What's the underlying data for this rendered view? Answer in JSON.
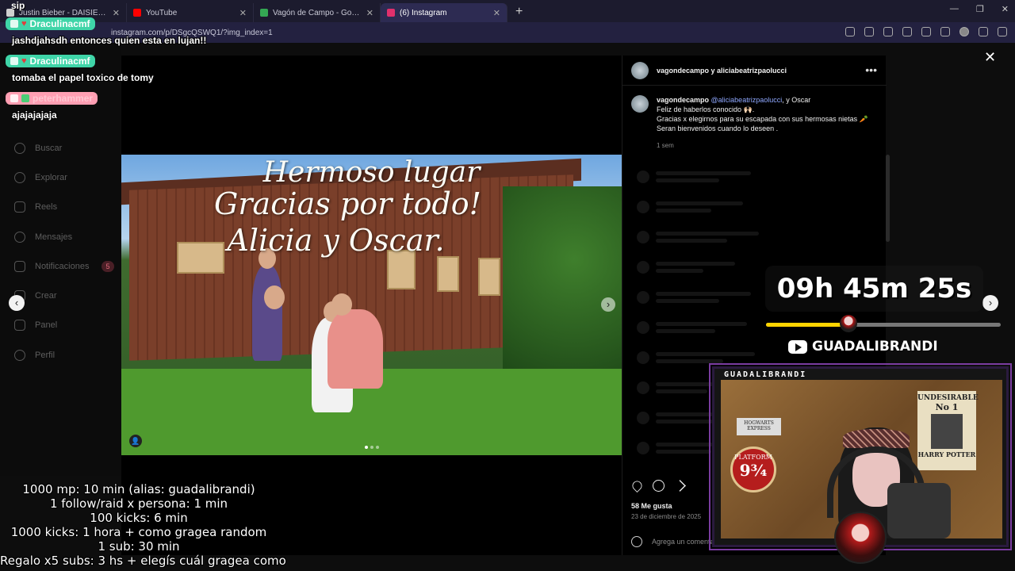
{
  "browser": {
    "tabs": [
      {
        "title": "Justin Bieber - DAISIES (Audio)",
        "color": "#d0d0d0",
        "active": false
      },
      {
        "title": "YouTube",
        "color": "#ff0000",
        "active": false
      },
      {
        "title": "Vagón de Campo - Google Maps",
        "color": "#34a853",
        "active": false
      },
      {
        "title": "(6) Instagram",
        "color": "#e1306c",
        "active": true
      }
    ],
    "url": "instagram.com/p/DSgcQSWQ1/?img_index=1"
  },
  "ig_sidebar": [
    {
      "label": "Buscar",
      "icon": "search-icon"
    },
    {
      "label": "Explorar",
      "icon": "compass-icon"
    },
    {
      "label": "Reels",
      "icon": "reels-icon"
    },
    {
      "label": "Mensajes",
      "icon": "messenger-icon"
    },
    {
      "label": "Notificaciones",
      "icon": "heart-icon",
      "badge": "5"
    },
    {
      "label": "Crear",
      "icon": "plus-icon"
    },
    {
      "label": "Panel",
      "icon": "dashboard-icon"
    },
    {
      "label": "Perfil",
      "icon": "profile-icon"
    }
  ],
  "post": {
    "image_text": [
      "Hermoso lugar",
      "Gracias por todo!",
      "Alicia y Oscar."
    ],
    "header_users": "vagondecampo y aliciabeatrizpaolucci",
    "caption_user": "vagondecampo",
    "caption_mention": "@aliciabeatrizpaolucci",
    "caption_after_mention": ", y Oscar",
    "caption_lines": [
      "Feliz de haberlos conocido 🙌🏻.",
      "Gracias x elegirnos para su escapada con sus hermosas nietas 🥕",
      "Seran bienvenidos cuando lo deseen ."
    ],
    "caption_time": "1 sem",
    "likes": "58 Me gusta",
    "date": "23 de diciembre de 2025",
    "comment_placeholder": "Agrega un comentario..."
  },
  "chat": [
    {
      "user": "Draculinacmf",
      "message": "jashdjahsdh entonces quien esta en lujan!!",
      "color": "#3fd5a8"
    },
    {
      "user": "Draculinacmf",
      "message": "tomaba el papel toxico de tomy",
      "color": "#3fd5a8"
    },
    {
      "user": "peterhammer",
      "message": "ajajajajaja",
      "color": "#ff9fb3"
    }
  ],
  "chat_prefix": "sip",
  "rules": [
    "1000 mp: 10 min (alias: guadalibrandi)",
    "1 follow/raid x persona: 1 min",
    "100 kicks: 6 min",
    "1000 kicks: 1 hora + como gragea random",
    "1 sub: 30 min",
    "Regalo x5 subs: 3 hs + elegís cuál gragea como"
  ],
  "timer": {
    "text": "09h 45m 25s",
    "progress": 0.35
  },
  "youtube_handle": "GUADALIBRANDI",
  "cam": {
    "label": "GUADALIBRANDI",
    "poster_title": "UNDESIRABLE",
    "poster_no": "No 1",
    "poster_name": "HARRY POTTER",
    "platform_text": "PLATFORM",
    "platform_no": "9¾",
    "hogwarts_text": "HOGWARTS EXPRESS"
  }
}
